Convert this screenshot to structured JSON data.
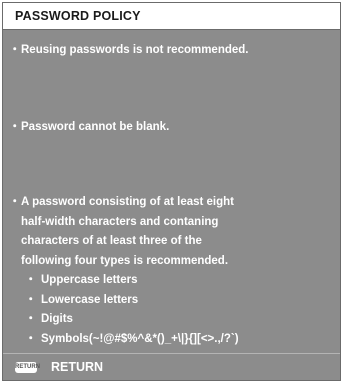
{
  "window": {
    "title": "PASSWORD POLICY"
  },
  "policy": {
    "bullet": "・",
    "item1": "Reusing passwords is not recommended.",
    "item2": "Password cannot be blank.",
    "item3_lines": [
      "A password consisting of at least eight",
      "half-width characters and contaning",
      "characters of at least three of the",
      "following four types is recommended."
    ],
    "types": [
      "Uppercase letters",
      "Lowercase letters",
      "Digits",
      "Symbols(~!@#$%^&*()_+\\|}{][<>.,/?`)"
    ]
  },
  "footer": {
    "return_key": "RETURN",
    "return_label": "RETURN"
  }
}
